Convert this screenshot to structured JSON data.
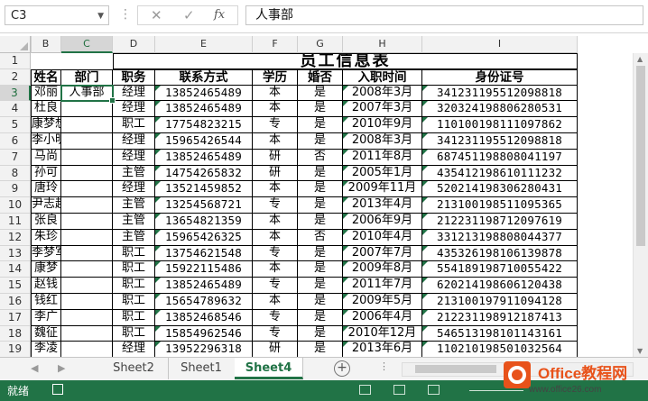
{
  "formula_bar": {
    "name_box": "C3",
    "cancel_icon": "✕",
    "enter_icon": "✓",
    "fx_label": "fx",
    "content": "人事部"
  },
  "grid": {
    "column_headers": [
      "B",
      "C",
      "D",
      "E",
      "F",
      "G",
      "H",
      "I"
    ],
    "selected_column": "C",
    "row_numbers": [
      "1",
      "2",
      "3",
      "4",
      "5",
      "6",
      "7",
      "8",
      "9",
      "10",
      "11",
      "12",
      "13",
      "14",
      "15",
      "16",
      "17",
      "18",
      "19"
    ],
    "selected_row": "3",
    "title": "员工信息表",
    "headers": [
      "姓名",
      "部门",
      "职务",
      "联系方式",
      "学历",
      "婚否",
      "入职时间",
      "身份证号"
    ],
    "rows": [
      [
        "邓丽",
        "人事部",
        "经理",
        "13852465489",
        "本",
        "是",
        "2008年3月",
        "341231195512098818"
      ],
      [
        "杜良",
        "",
        "经理",
        "13852465489",
        "本",
        "是",
        "2007年3月",
        "320324198806280531"
      ],
      [
        "康梦想",
        "",
        "职工",
        "17754823215",
        "专",
        "是",
        "2010年9月",
        "110100198111097862"
      ],
      [
        "李小明",
        "",
        "经理",
        "15965426544",
        "本",
        "是",
        "2008年3月",
        "341231195512098818"
      ],
      [
        "马尚",
        "",
        "经理",
        "13852465489",
        "研",
        "否",
        "2011年8月",
        "687451198808041197"
      ],
      [
        "孙可",
        "",
        "主管",
        "14754265832",
        "研",
        "是",
        "2005年1月",
        "435412198610111232"
      ],
      [
        "唐玲",
        "",
        "经理",
        "13521459852",
        "本",
        "是",
        "2009年11月",
        "520214198306280431"
      ],
      [
        "尹志超",
        "",
        "主管",
        "13254568721",
        "专",
        "是",
        "2013年4月",
        "213100198511095365"
      ],
      [
        "张良",
        "",
        "主管",
        "13654821359",
        "本",
        "是",
        "2006年9月",
        "212231198712097619"
      ],
      [
        "朱珍",
        "",
        "主管",
        "15965426325",
        "本",
        "否",
        "2010年4月",
        "331213198808044377"
      ],
      [
        "李梦军",
        "",
        "职工",
        "13754621548",
        "专",
        "是",
        "2007年7月",
        "435326198106139878"
      ],
      [
        "康梦",
        "",
        "职工",
        "15922115486",
        "本",
        "是",
        "2009年8月",
        "554189198710055422"
      ],
      [
        "赵钱",
        "",
        "职工",
        "13852465489",
        "专",
        "是",
        "2011年7月",
        "620214198606120438"
      ],
      [
        "钱红",
        "",
        "职工",
        "15654789632",
        "本",
        "是",
        "2009年5月",
        "213100197911094128"
      ],
      [
        "李广",
        "",
        "职工",
        "13852468546",
        "专",
        "是",
        "2006年4月",
        "212231198912187413"
      ],
      [
        "魏征",
        "",
        "职工",
        "15854962546",
        "专",
        "是",
        "2010年12月",
        "546513198101143161"
      ],
      [
        "李凌",
        "",
        "经理",
        "13952296318",
        "研",
        "是",
        "2013年6月",
        "110210198501032564"
      ]
    ]
  },
  "sheet_tabs": {
    "nav_prev": "◀",
    "nav_next": "▶",
    "tabs": [
      "Sheet2",
      "Sheet1",
      "Sheet4"
    ],
    "active": "Sheet4",
    "add_icon": "+"
  },
  "status_bar": {
    "ready_label": "就绪"
  },
  "watermark": {
    "brand": "Office教程网",
    "url": "www.office26.com"
  },
  "colors": {
    "accent": "#217346",
    "status_bar": "#217346",
    "watermark_orange": "#e8521a"
  }
}
